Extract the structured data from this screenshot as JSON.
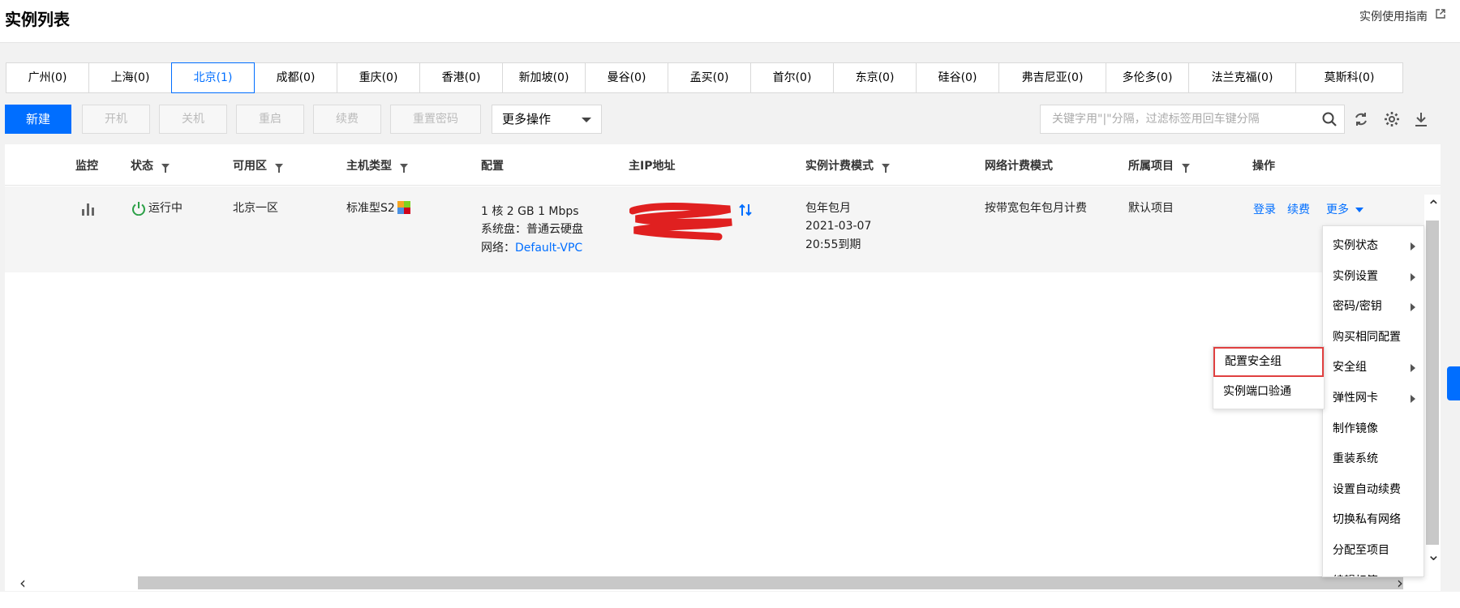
{
  "header": {
    "title": "实例列表",
    "guide_link": "实例使用指南"
  },
  "regions": [
    {
      "label": "广州(0)",
      "active": false
    },
    {
      "label": "上海(0)",
      "active": false
    },
    {
      "label": "北京(1)",
      "active": true
    },
    {
      "label": "成都(0)",
      "active": false
    },
    {
      "label": "重庆(0)",
      "active": false
    },
    {
      "label": "香港(0)",
      "active": false
    },
    {
      "label": "新加坡(0)",
      "active": false
    },
    {
      "label": "曼谷(0)",
      "active": false
    },
    {
      "label": "孟买(0)",
      "active": false
    },
    {
      "label": "首尔(0)",
      "active": false
    },
    {
      "label": "东京(0)",
      "active": false
    },
    {
      "label": "硅谷(0)",
      "active": false
    },
    {
      "label": "弗吉尼亚(0)",
      "active": false
    },
    {
      "label": "多伦多(0)",
      "active": false
    },
    {
      "label": "法兰克福(0)",
      "active": false
    },
    {
      "label": "莫斯科(0)",
      "active": false
    }
  ],
  "toolbar": {
    "new": "新建",
    "start": "开机",
    "stop": "关机",
    "restart": "重启",
    "renew": "续费",
    "reset_password": "重置密码",
    "more_ops": "更多操作",
    "search_placeholder": "关键字用\"|\"分隔，过滤标签用回车键分隔"
  },
  "table": {
    "headers": {
      "monitor": "监控",
      "status": "状态",
      "zone": "可用区",
      "type": "主机类型",
      "config": "配置",
      "ip": "主IP地址",
      "billing": "实例计费模式",
      "net_billing": "网络计费模式",
      "project": "所属项目",
      "ops": "操作"
    },
    "row": {
      "status": "运行中",
      "zone": "北京一区",
      "type": "标准型S2",
      "config_line1": "1 核 2 GB 1 Mbps",
      "config_line2": "系统盘：普通云硬盘",
      "config_line3_label": "网络：",
      "config_line3_link": "Default-VPC",
      "billing_line1": "包年包月",
      "billing_line2": "2021-03-07",
      "billing_line3": "20:55到期",
      "net_billing": "按带宽包年包月计费",
      "project": "默认项目",
      "op_login": "登录",
      "op_renew": "续费",
      "op_more": "更多"
    }
  },
  "more_menu": [
    {
      "label": "实例状态",
      "has_sub": true
    },
    {
      "label": "实例设置",
      "has_sub": true
    },
    {
      "label": "密码/密钥",
      "has_sub": true
    },
    {
      "label": "购买相同配置",
      "has_sub": false
    },
    {
      "label": "安全组",
      "has_sub": true
    },
    {
      "label": "弹性网卡",
      "has_sub": true
    },
    {
      "label": "制作镜像",
      "has_sub": false
    },
    {
      "label": "重装系统",
      "has_sub": false
    },
    {
      "label": "设置自动续费",
      "has_sub": false
    },
    {
      "label": "切换私有网络",
      "has_sub": false
    },
    {
      "label": "分配至项目",
      "has_sub": false
    },
    {
      "label": "编辑标签",
      "has_sub": false
    }
  ],
  "security_submenu": [
    {
      "label": "配置安全组",
      "highlighted": true
    },
    {
      "label": "实例端口验通",
      "highlighted": false
    }
  ],
  "colors": {
    "accent": "#006eff",
    "running": "#2ca048",
    "highlight_border": "#e04040",
    "redaction": "#e02020"
  }
}
